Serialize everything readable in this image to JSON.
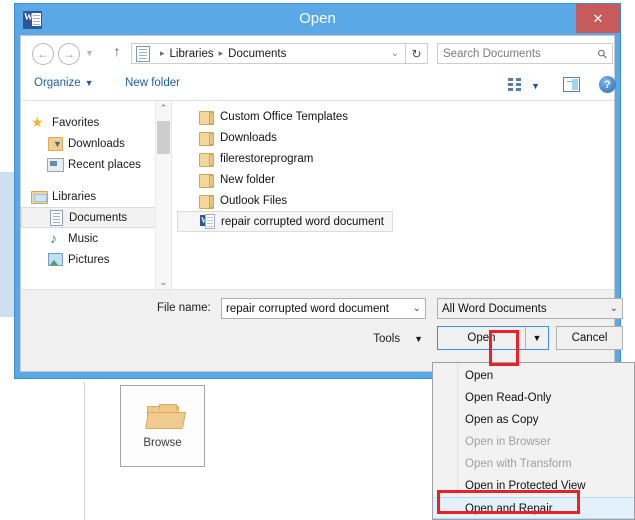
{
  "window": {
    "title": "Open",
    "app_icon": "word-icon",
    "close_label": "✕",
    "accent_color": "#5aa9e6"
  },
  "address_bar": {
    "back_icon": "←",
    "forward_icon": "→",
    "recent_icon": "▼",
    "up_icon": "↑",
    "path_icon": "library-document-icon",
    "crumbs": [
      "Libraries",
      "Documents"
    ],
    "crumb_separator": "▸",
    "path_dropdown_icon": "⌄",
    "refresh_icon": "↻",
    "search_placeholder": "Search Documents",
    "search_icon": "⚲"
  },
  "command_bar": {
    "organize_label": "Organize",
    "organize_caret": "▼",
    "new_folder_label": "New folder",
    "view_icon": "view-options-icon",
    "view_caret": "▼",
    "preview_pane_icon": "preview-pane-icon",
    "help_icon": "?"
  },
  "nav_pane": {
    "groups": [
      {
        "header": {
          "label": "Favorites",
          "icon": "star-icon"
        },
        "items": [
          {
            "label": "Downloads",
            "icon": "downloads-folder-icon",
            "selected": false
          },
          {
            "label": "Recent places",
            "icon": "recent-places-icon",
            "selected": false
          }
        ]
      },
      {
        "header": {
          "label": "Libraries",
          "icon": "libraries-icon"
        },
        "items": [
          {
            "label": "Documents",
            "icon": "document-icon",
            "selected": true
          },
          {
            "label": "Music",
            "icon": "music-note-icon",
            "selected": false
          },
          {
            "label": "Pictures",
            "icon": "picture-icon",
            "selected": false
          }
        ]
      }
    ],
    "scrollbar": {
      "up_arrow": "⌃",
      "down_arrow": "⌄"
    }
  },
  "file_list": {
    "items": [
      {
        "name": "Custom Office Templates",
        "type": "folder",
        "selected": false
      },
      {
        "name": "Downloads",
        "type": "folder",
        "selected": false
      },
      {
        "name": "filerestoreprogram",
        "type": "folder",
        "selected": false
      },
      {
        "name": "New folder",
        "type": "folder",
        "selected": false
      },
      {
        "name": "Outlook Files",
        "type": "folder",
        "selected": false
      },
      {
        "name": "repair corrupted word document",
        "type": "word-document",
        "selected": true
      }
    ]
  },
  "footer": {
    "file_name_label": "File name:",
    "file_name_value": "repair corrupted word document",
    "file_name_caret": "⌄",
    "file_type_value": "All Word Documents",
    "file_type_caret": "⌄",
    "tools_label": "Tools",
    "tools_caret": "▼",
    "open_label": "Open",
    "open_split_caret": "▼",
    "cancel_label": "Cancel"
  },
  "open_dropdown": {
    "items": [
      {
        "label": "Open",
        "disabled": false,
        "highlighted": false
      },
      {
        "label": "Open Read-Only",
        "disabled": false,
        "highlighted": false
      },
      {
        "label": "Open as Copy",
        "disabled": false,
        "highlighted": false
      },
      {
        "label": "Open in Browser",
        "disabled": true,
        "highlighted": false
      },
      {
        "label": "Open with Transform",
        "disabled": true,
        "highlighted": false
      },
      {
        "label": "Open in Protected View",
        "disabled": false,
        "highlighted": false
      },
      {
        "label": "Open and Repair",
        "disabled": false,
        "highlighted": true
      }
    ]
  },
  "background": {
    "browse_label": "Browse",
    "browse_icon": "open-folder-icon"
  },
  "annotations": {
    "highlight_color": "#ec2027",
    "boxes": [
      "open-split-arrow",
      "open-and-repair-item"
    ]
  }
}
